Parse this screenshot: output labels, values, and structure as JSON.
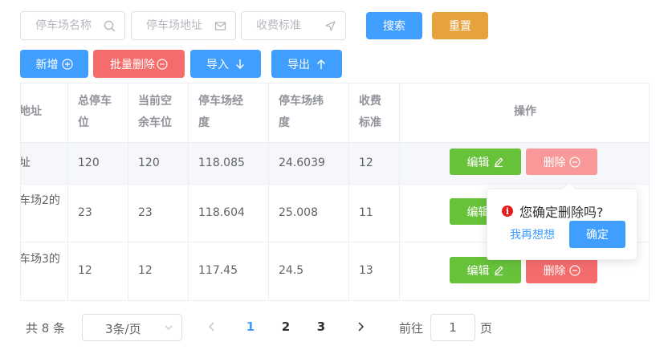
{
  "search": {
    "name_placeholder": "停车场名称",
    "address_placeholder": "停车场地址",
    "fee_placeholder": "收费标准",
    "search_label": "搜索",
    "reset_label": "重置"
  },
  "toolbar": {
    "add_label": "新增",
    "batch_delete_label": "批量删除",
    "import_label": "导入",
    "export_label": "导出"
  },
  "table": {
    "headers": {
      "address": "地址",
      "total_spaces_1": "总停车",
      "total_spaces_2": "位",
      "free_spaces_1": "当前空",
      "free_spaces_2": "余车位",
      "longitude_1": "停车场经",
      "longitude_2": "度",
      "latitude_1": "停车场纬",
      "latitude_2": "度",
      "fee_1": "收费",
      "fee_2": "标准",
      "actions": "操作"
    },
    "rows": [
      {
        "address_1": "址",
        "address_2": "",
        "total": "120",
        "free": "120",
        "longitude": "118.085",
        "latitude": "24.6039",
        "fee": "12"
      },
      {
        "address_1": "车场2的",
        "address_2": "",
        "total": "23",
        "free": "23",
        "longitude": "118.604",
        "latitude": "25.008",
        "fee": "11"
      },
      {
        "address_1": "车场3的",
        "address_2": "",
        "total": "12",
        "free": "12",
        "longitude": "117.45",
        "latitude": "24.5",
        "fee": "13"
      }
    ],
    "edit_label": "编辑",
    "delete_label": "删除"
  },
  "popconfirm": {
    "message": "您确定删除吗?",
    "cancel_label": "我再想想",
    "confirm_label": "确定"
  },
  "pagination": {
    "total_prefix": "共",
    "total": "8",
    "total_suffix": "条",
    "page_size": "3条/页",
    "pages": [
      "1",
      "2",
      "3"
    ],
    "current_page": "1",
    "goto_prefix": "前往",
    "goto_value": "1",
    "goto_suffix": "页"
  },
  "colors": {
    "primary": "#409eff",
    "warning": "#e6a23c",
    "danger": "#f56c6c",
    "success": "#67c23a"
  }
}
